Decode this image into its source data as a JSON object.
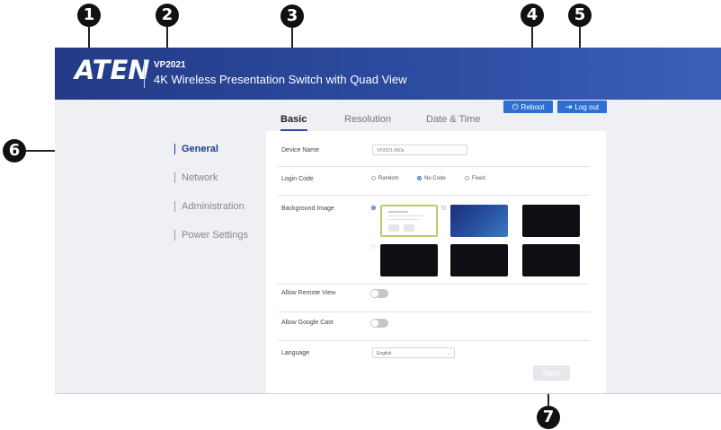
{
  "callouts": [
    "1",
    "2",
    "3",
    "4",
    "5",
    "6",
    "7"
  ],
  "header": {
    "logo": "ATEN",
    "model": "VP2021",
    "subtitle": "4K Wireless Presentation Switch with Quad View"
  },
  "tabs": [
    {
      "label": "Basic",
      "active": true
    },
    {
      "label": "Resolution",
      "active": false
    },
    {
      "label": "Date & Time",
      "active": false
    }
  ],
  "buttons": {
    "reboot": {
      "label": "Reboot",
      "icon": "power-icon"
    },
    "logout": {
      "label": "Log out",
      "icon": "logout-icon"
    },
    "apply": "Apply"
  },
  "sidebar": {
    "items": [
      {
        "label": "General",
        "active": true
      },
      {
        "label": "Network",
        "active": false
      },
      {
        "label": "Administration",
        "active": false
      },
      {
        "label": "Power Settings",
        "active": false
      }
    ]
  },
  "form": {
    "device_name": {
      "label": "Device Name",
      "value": "VP2021-060a"
    },
    "login_code": {
      "label": "Login Code",
      "options": [
        "Random",
        "No Code",
        "Fixed"
      ],
      "selected": "No Code"
    },
    "background_image": {
      "label": "Background Image",
      "selected_index": 0,
      "count": 6
    },
    "allow_remote_view": {
      "label": "Allow Remote View",
      "enabled": false
    },
    "allow_google_cast": {
      "label": "Allow Google Cast",
      "enabled": false
    },
    "language": {
      "label": "Language",
      "value": "English"
    }
  },
  "colors": {
    "header_start": "#243b86",
    "header_end": "#3b5fb7",
    "accent": "#2f6fd1",
    "active_nav": "#1f3c8a"
  }
}
